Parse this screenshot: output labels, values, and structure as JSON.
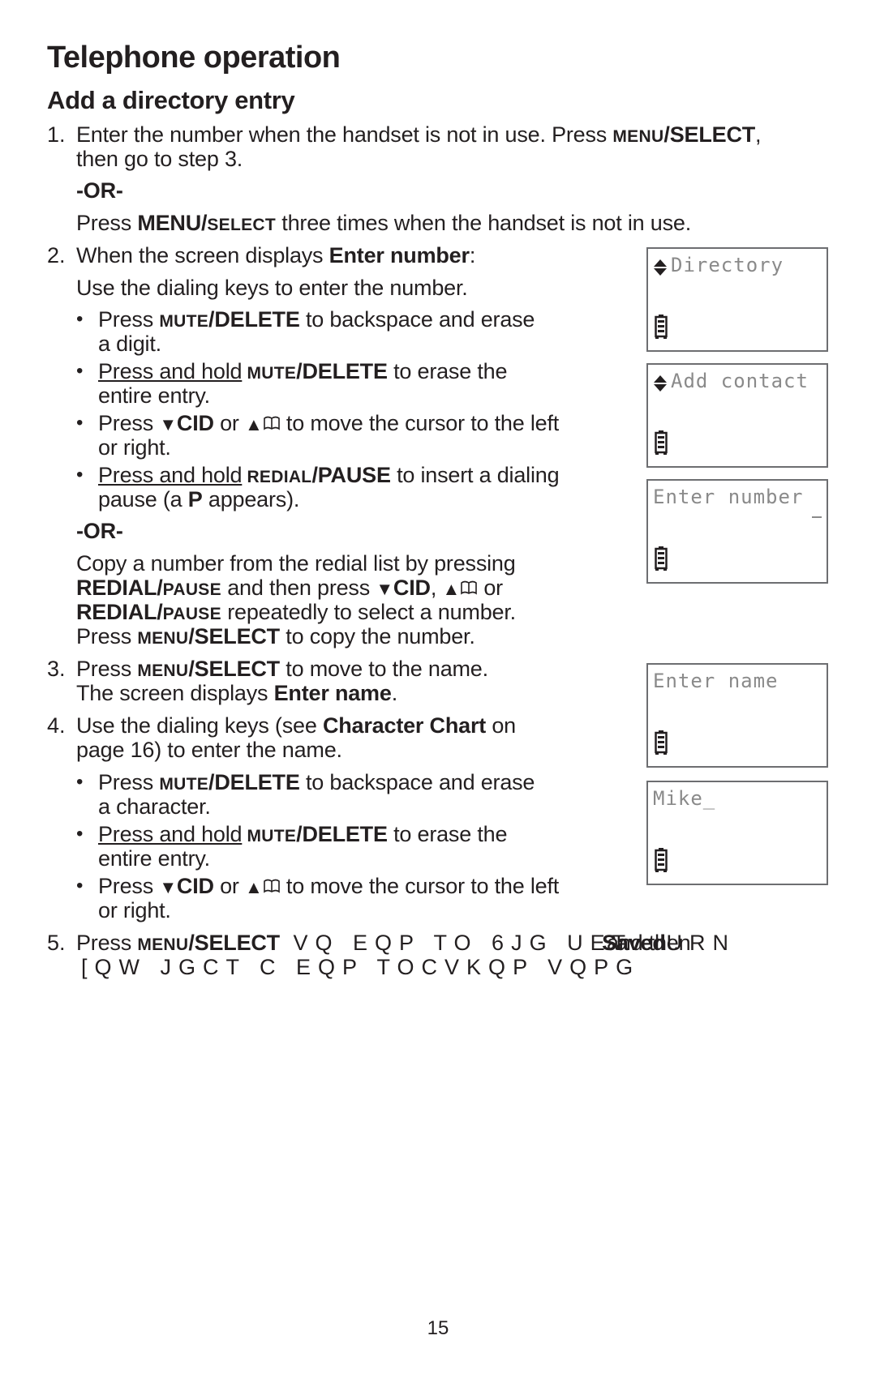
{
  "page": {
    "section_title": "Telephone operation",
    "subsection_title": "Add a directory entry",
    "page_number": "15"
  },
  "steps": {
    "s1": {
      "num": "1.",
      "l1_a": "Enter the number when the handset is not in use. Press ",
      "l1_menu": "MENU",
      "l1_select": "/SELECT",
      "l1_b": ",",
      "l2": "then go to step 3.",
      "or": "-OR-",
      "l3_a": "Press ",
      "l3_menu": "MENU/",
      "l3_select": "SELECT",
      "l3_b": " three times when the handset is not in use."
    },
    "s2": {
      "num": "2.",
      "l1_a": "When the screen displays ",
      "l1_bold": "Enter number",
      "l1_b": ":",
      "l2": "Use the dialing keys to enter the number.",
      "b1_a": "Press ",
      "b1_mute": "MUTE",
      "b1_delete": "/DELETE",
      "b1_b": " to backspace and erase",
      "b1_c": "a digit.",
      "b2_u": "Press and hold",
      "b2_mute": " MUTE",
      "b2_delete": "/DELETE",
      "b2_b": " to erase the",
      "b2_c": "entire entry.",
      "b3_a": "Press ",
      "b3_down": "▼",
      "b3_cid": "CID",
      "b3_or": " or ",
      "b3_up": "▲",
      "b3_book": "📖",
      "b3_b": " to move the cursor to the left",
      "b3_c": "or right.",
      "b4_u": "Press and hold",
      "b4_redial": " REDIAL",
      "b4_pause": "/PAUSE",
      "b4_b": " to insert a dialing",
      "b4_c_a": "pause (a ",
      "b4_c_p": "P",
      "b4_c_b": " appears).",
      "or": "-OR-",
      "c1": "Copy a number from the redial list by pressing",
      "c2_redial": "REDIAL/",
      "c2_pause": "PAUSE",
      "c2_a": " and then press ",
      "c2_cid": "CID",
      "c2_b": ", ",
      "c2_c": " or",
      "c3_redial": "REDIAL/",
      "c3_pause": "PAUSE",
      "c3_a": " repeatedly to select a number.",
      "c4_a": "Press ",
      "c4_menu": "MENU",
      "c4_select": "/SELECT",
      "c4_b": " to copy the number."
    },
    "s3": {
      "num": "3.",
      "l1_a": "Press ",
      "l1_menu": "MENU",
      "l1_select": "/SELECT",
      "l1_b": " to move to the name.",
      "l2_a": "The screen displays ",
      "l2_bold": "Enter name",
      "l2_b": "."
    },
    "s4": {
      "num": "4.",
      "l1_a": "Use the dialing keys (see ",
      "l1_bold": "Character Chart",
      "l1_b": " on",
      "l2": "page 16) to enter the name.",
      "b1_a": "Press ",
      "b1_mute": "MUTE",
      "b1_delete": "/DELETE",
      "b1_b": " to backspace and erase",
      "b1_c": "a character.",
      "b2_u": "Press and hold",
      "b2_mute": " MUTE",
      "b2_delete": "/DELETE",
      "b2_b": " to erase the",
      "b2_c": "entire entry.",
      "b3_a": "Press ",
      "b3_cid": "CID",
      "b3_or": " or ",
      "b3_b": " to move the cursor to the left",
      "b3_c": "or right."
    },
    "s5": {
      "num": "5.",
      "l1_a": "Press ",
      "l1_menu": "MENU",
      "l1_select": "/SELECT",
      "l1_garble": " VQ EQP TO 6JG UET",
      "l1_saved": "Saved",
      "l1_overlap": " and then",
      "l1_garble2": "URN",
      "l2_garble": "[QW JGCT C EQP TOCVKQP VQPG"
    }
  },
  "screens": [
    {
      "name": "directory",
      "text": "Directory",
      "arrow": true
    },
    {
      "name": "add-contact",
      "text": "Add contact",
      "arrow": true
    },
    {
      "name": "enter-number",
      "text": "Enter number",
      "arrow": false,
      "cursor": true
    },
    {
      "name": "enter-name",
      "text": "Enter name",
      "arrow": false
    },
    {
      "name": "mike",
      "text": "Mike_",
      "arrow": false
    }
  ],
  "icons": {
    "bullet": "•",
    "down": "▼",
    "up": "▲"
  }
}
